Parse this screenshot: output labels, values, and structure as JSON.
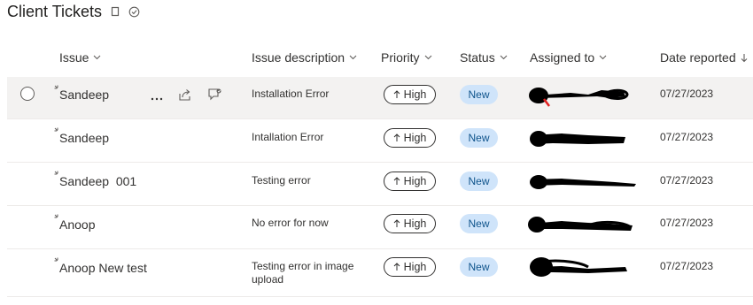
{
  "list_title": "Client Tickets",
  "title_icons": [
    "view-icon",
    "status-check-icon"
  ],
  "columns": [
    {
      "label": "Issue",
      "sort_icon": "chevron-down-icon"
    },
    {
      "label": "Issue description",
      "sort_icon": "chevron-down-icon"
    },
    {
      "label": "Priority",
      "sort_icon": "chevron-down-icon"
    },
    {
      "label": "Status",
      "sort_icon": "chevron-down-icon"
    },
    {
      "label": "Assigned to",
      "sort_icon": "chevron-down-icon"
    },
    {
      "label": "Date reported",
      "sort_icon": "arrow-down-icon"
    }
  ],
  "row_actions": [
    "more-icon",
    "share-icon",
    "comment-icon"
  ],
  "rows": [
    {
      "issue": "Sandeep",
      "description": "Installation Error",
      "priority": "High",
      "status": "New",
      "date": "07/27/2023"
    },
    {
      "issue": "Sandeep",
      "description": "Intallation Error",
      "priority": "High",
      "status": "New",
      "date": "07/27/2023"
    },
    {
      "issue": "Sandeep  001",
      "description": "Testing error",
      "priority": "High",
      "status": "New",
      "date": "07/27/2023"
    },
    {
      "issue": "Anoop",
      "description": "No error for now",
      "priority": "High",
      "status": "New",
      "date": "07/27/2023"
    },
    {
      "issue": "Anoop New test",
      "description": "Testing error in image upload",
      "priority": "High",
      "status": "New",
      "date": "07/27/2023"
    }
  ],
  "colors": {
    "new_pill_bg": "#cfe4fa",
    "new_pill_text": "#0f548c",
    "selected_row_bg": "#f3f2f1",
    "redaction": "#000000"
  }
}
